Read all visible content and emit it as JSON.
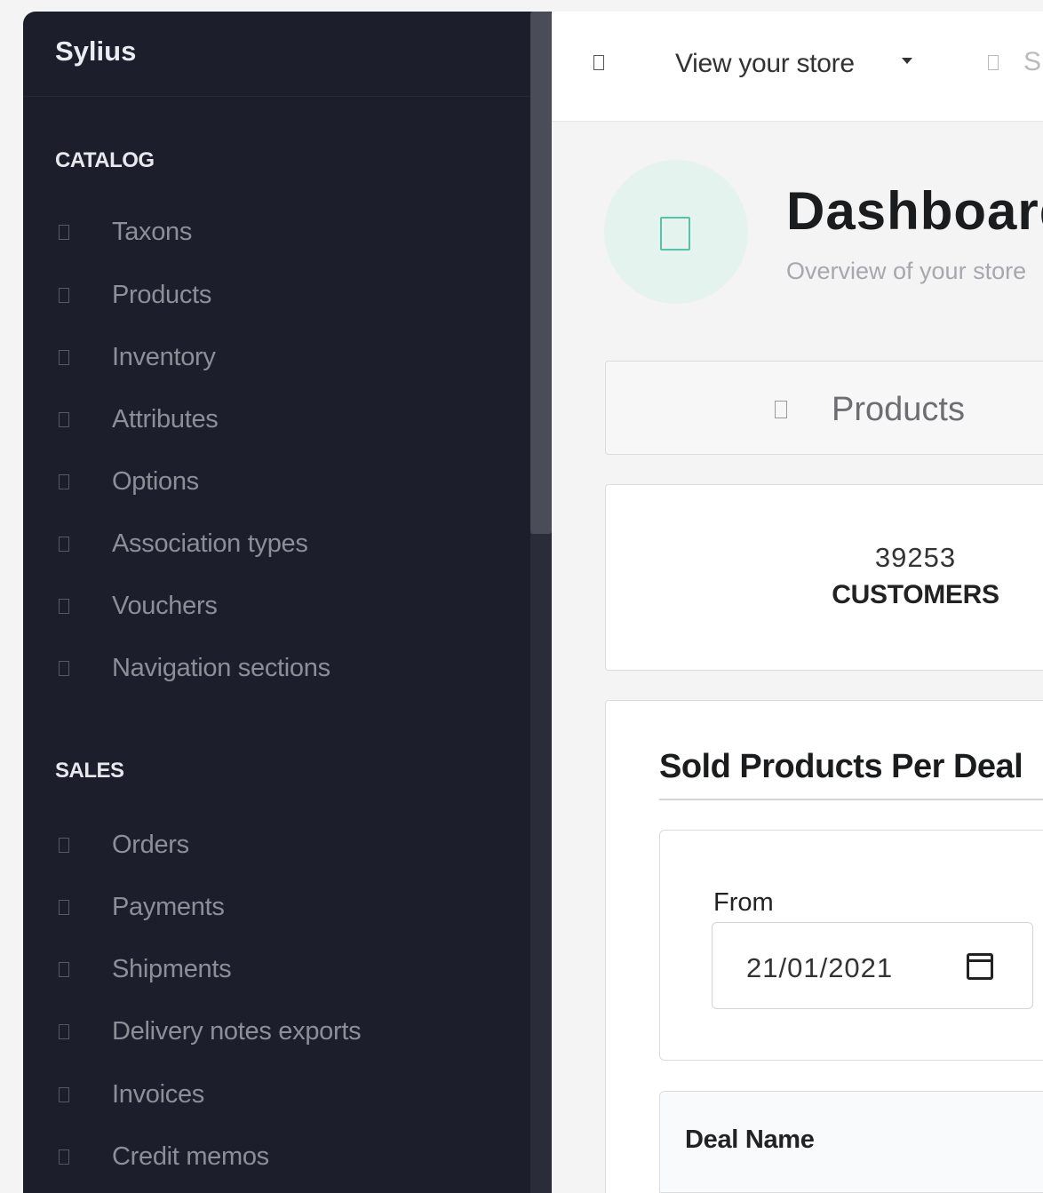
{
  "sidebar": {
    "brand": "Sylius",
    "sections": [
      {
        "title": "CATALOG",
        "items": [
          {
            "label": "Taxons"
          },
          {
            "label": "Products"
          },
          {
            "label": "Inventory"
          },
          {
            "label": "Attributes"
          },
          {
            "label": "Options"
          },
          {
            "label": "Association types"
          },
          {
            "label": "Vouchers"
          },
          {
            "label": "Navigation sections"
          }
        ]
      },
      {
        "title": "SALES",
        "items": [
          {
            "label": "Orders"
          },
          {
            "label": "Payments"
          },
          {
            "label": "Shipments"
          },
          {
            "label": "Delivery notes exports"
          },
          {
            "label": "Invoices"
          },
          {
            "label": "Credit memos"
          }
        ]
      }
    ]
  },
  "topbar": {
    "store_link": "View your store",
    "search_peek": "S"
  },
  "header": {
    "title": "Dashboard",
    "subtitle": "Overview of your store"
  },
  "tabs": {
    "products_label": "Products"
  },
  "stats": {
    "customers_value": "39253",
    "customers_label": "CUSTOMERS"
  },
  "deals": {
    "title": "Sold Products Per Deal",
    "from_label": "From",
    "from_value": "21/01/2021",
    "columns": [
      "Deal Name"
    ]
  },
  "colors": {
    "sidebar_bg": "#1c1f2b",
    "accent": "#56c2a7"
  }
}
